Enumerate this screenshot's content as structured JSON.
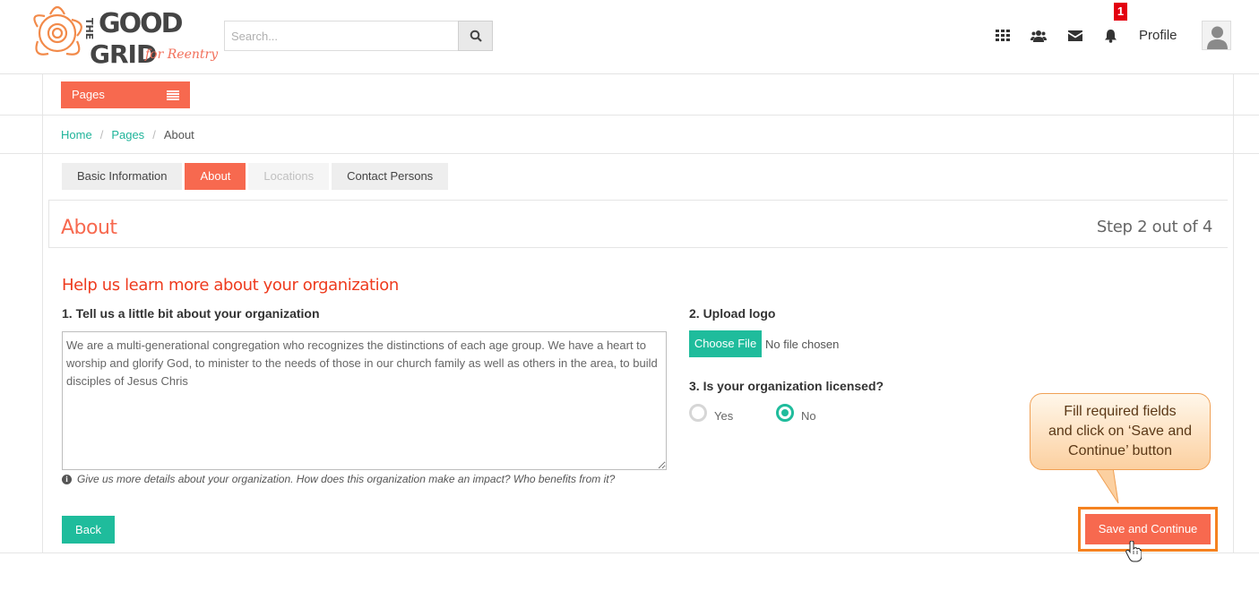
{
  "header": {
    "logo_text": [
      "THE",
      "GOOD",
      "GRID",
      "for Reentry"
    ],
    "search_placeholder": "Search...",
    "notifications_count": "1",
    "profile_label": "Profile",
    "icons": [
      "grid-icon",
      "users-icon",
      "envelope-icon",
      "bell-icon"
    ]
  },
  "pages_menu": {
    "label": "Pages"
  },
  "breadcrumb": {
    "home": "Home",
    "pages": "Pages",
    "current": "About"
  },
  "tabs": [
    {
      "label": "Basic Information",
      "state": "normal"
    },
    {
      "label": "About",
      "state": "active"
    },
    {
      "label": "Locations",
      "state": "disabled"
    },
    {
      "label": "Contact Persons",
      "state": "normal"
    }
  ],
  "section": {
    "title": "About",
    "step": "Step 2 out of 4"
  },
  "form": {
    "heading": "Help us learn more about your organization",
    "q1_label": "1. Tell us a little bit about your organization",
    "q1_value": "We are a multi-generational congregation who recognizes the distinctions of each age group. We have a heart to worship and glorify God, to minister to the needs of those in our church family as well as others in the area, to build disciples of Jesus Chris",
    "q1_hint": "Give us more details about your organization. How does this organization make an impact? Who benefits from it?",
    "q2_label": "2. Upload logo",
    "choose_file_label": "Choose File",
    "no_file_text": "No file chosen",
    "q3_label": "3. Is your organization licensed?",
    "yes_label": "Yes",
    "no_label": "No",
    "licensed_selected": "No"
  },
  "actions": {
    "back_label": "Back",
    "save_label": "Save and Continue"
  },
  "callout": {
    "line1": "Fill required fields",
    "line2": "and click on ‘Save and",
    "line3": "Continue’ button"
  },
  "colors": {
    "accent": "#f7694f",
    "teal": "#1fbc9c",
    "callout_border": "#f58220",
    "badge": "#e3000f"
  }
}
